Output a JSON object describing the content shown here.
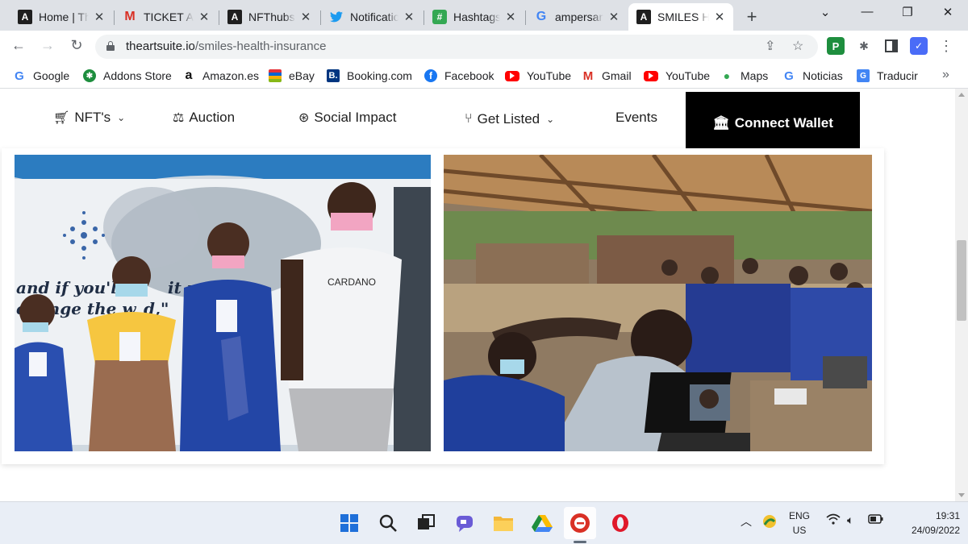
{
  "browser": {
    "tabs": [
      {
        "title": "Home | Th",
        "icon": "artsuite-icon"
      },
      {
        "title": "TICKET A",
        "icon": "gmail-icon"
      },
      {
        "title": "NFThubs",
        "icon": "artsuite-icon"
      },
      {
        "title": "Notificatio",
        "icon": "twitter-icon"
      },
      {
        "title": "Hashtags",
        "icon": "hashtag-icon"
      },
      {
        "title": "ampersan",
        "icon": "google-icon"
      },
      {
        "title": "SMILES H",
        "icon": "artsuite-icon",
        "active": true
      }
    ],
    "address": {
      "domain": "theartsuite.io",
      "path": "/smiles-health-insurance"
    },
    "bookmarks": [
      {
        "label": "Google",
        "icon": "google-icon"
      },
      {
        "label": "Addons Store",
        "icon": "addons-icon"
      },
      {
        "label": "Amazon.es",
        "icon": "amazon-icon"
      },
      {
        "label": "eBay",
        "icon": "ebay-icon"
      },
      {
        "label": "Booking.com",
        "icon": "booking-icon"
      },
      {
        "label": "Facebook",
        "icon": "facebook-icon"
      },
      {
        "label": "YouTube",
        "icon": "youtube-icon"
      },
      {
        "label": "Gmail",
        "icon": "gmail-icon"
      },
      {
        "label": "YouTube",
        "icon": "youtube-icon"
      },
      {
        "label": "Maps",
        "icon": "maps-icon"
      },
      {
        "label": "Noticias",
        "icon": "google-icon"
      },
      {
        "label": "Traducir",
        "icon": "translate-icon"
      }
    ]
  },
  "site": {
    "nav": {
      "nfts": "NFT's",
      "auction": "Auction",
      "social_impact": "Social Impact",
      "get_listed": "Get Listed",
      "events": "Events",
      "connect_wallet": "Connect Wallet"
    },
    "photo_left": {
      "banner_line1": "and if you'll",
      "banner_line1b": "it us",
      "banner_line2": "change the w",
      "banner_line2b": "d,\"",
      "shirt_text": "CARDANO"
    },
    "accent_color": "#000000"
  },
  "taskbar": {
    "lang_top": "ENG",
    "lang_bottom": "US",
    "time": "19:31",
    "date": "24/09/2022"
  }
}
